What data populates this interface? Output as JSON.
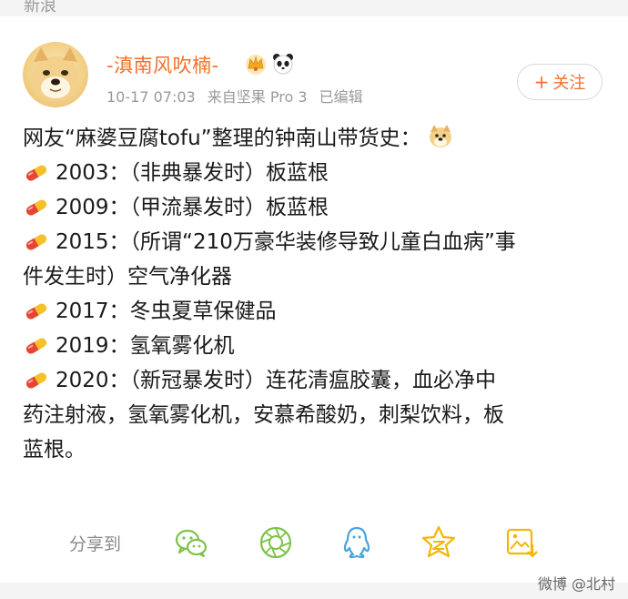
{
  "top_strip": {
    "text": "新浪"
  },
  "header": {
    "user_name": "-滇南风吹楠-",
    "time": "10-17 07:03",
    "source": "来自坚果 Pro 3",
    "edited": "已编辑",
    "follow_label": "关注",
    "follow_plus": "+"
  },
  "post": {
    "intro": "网友“麻婆豆腐tofu”整理的钟南山带货史：",
    "lines": [
      "2003：（非典暴发时）板蓝根",
      "2009：（甲流暴发时）板蓝根",
      "2015：（所谓“210万豪华装修导致儿童白血病”事",
      "件发生时）空气净化器",
      "2017：冬虫夏草保健品",
      "2019：氢氧雾化机",
      "2020：（新冠暴发时）连花清瘟胶囊，血必净中",
      "药注射液，氢氧雾化机，安慕希酸奶，刺梨饮料，板",
      "蓝根。"
    ]
  },
  "share": {
    "label": "分享到",
    "targets": [
      "wechat-icon",
      "moments-icon",
      "qq-icon",
      "qzone-icon",
      "save-image-icon"
    ]
  },
  "watermark": "微博 @北村",
  "colors": {
    "accent": "#f0702a",
    "share_green": "#7cc34a",
    "share_blue": "#4aa3df",
    "share_gold": "#f2b705"
  }
}
